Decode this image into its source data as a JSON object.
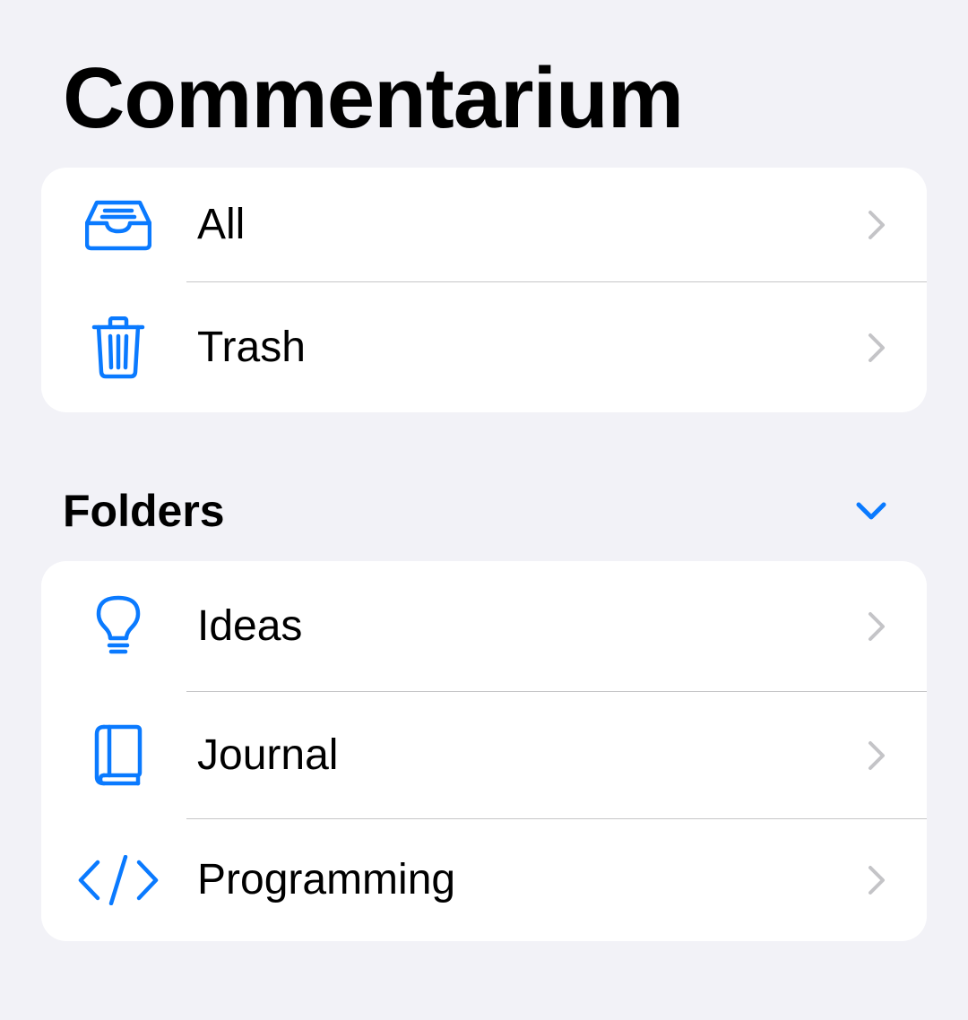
{
  "app": {
    "title": "Commentarium"
  },
  "colors": {
    "accent": "#0a7aff",
    "background": "#f2f2f7",
    "card": "#ffffff",
    "separator": "#c6c6c8",
    "chevron": "#c4c4c7"
  },
  "library": {
    "items": [
      {
        "label": "All",
        "icon": "tray-icon"
      },
      {
        "label": "Trash",
        "icon": "trash-icon"
      }
    ]
  },
  "folders": {
    "header": "Folders",
    "toggle_icon": "chevron-down-icon",
    "items": [
      {
        "label": "Ideas",
        "icon": "lightbulb-icon"
      },
      {
        "label": "Journal",
        "icon": "book-icon"
      },
      {
        "label": "Programming",
        "icon": "code-icon"
      }
    ]
  }
}
